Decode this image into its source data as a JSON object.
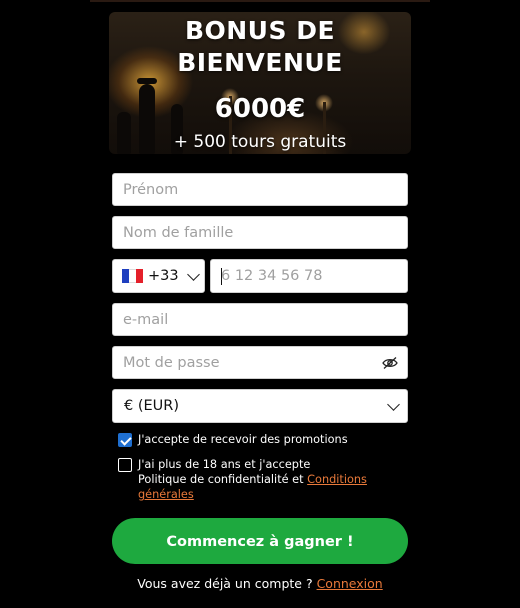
{
  "banner": {
    "title_line1": "BONUS DE",
    "title_line2": "BIENVENUE",
    "amount": "6000€",
    "subtitle": "+ 500 tours gratuits"
  },
  "form": {
    "first_name_placeholder": "Prénom",
    "last_name_placeholder": "Nom de famille",
    "phone": {
      "country_flag": "france-flag",
      "country_code": "+33",
      "number_placeholder": "6 12 34 56 78"
    },
    "email_placeholder": "e-mail",
    "password_placeholder": "Mot de passe",
    "currency_selected": "€ (EUR)",
    "promo_consent": {
      "checked": true,
      "label": "J'accepte de recevoir des promotions"
    },
    "terms_consent": {
      "checked": false,
      "line1": "J'ai plus de 18 ans et j'accepte",
      "line2_prefix": "Politique de confidentialité et ",
      "link_part1": "Conditions",
      "link_part2": "générales"
    },
    "submit_label": "Commencez à gagner !",
    "login_prompt": "Vous avez déjà un compte ? ",
    "login_link": "Connexion"
  },
  "colors": {
    "cta": "#1ea93f",
    "link": "#e8793a",
    "checkbox": "#1f6fd0"
  }
}
